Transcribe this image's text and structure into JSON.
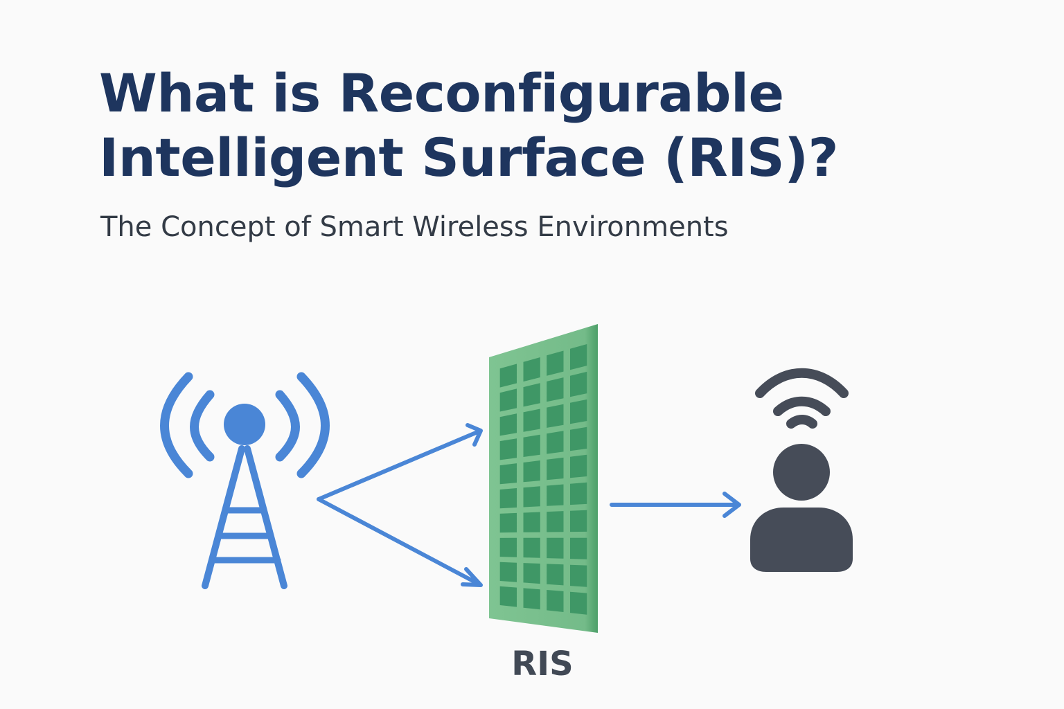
{
  "title": {
    "line1": "What is Reconfigurable",
    "line2": "Intelligent Surface (RIS)?"
  },
  "subtitle": "The Concept of Smart Wireless Environments",
  "diagram": {
    "ris_label": "RIS",
    "nodes": [
      {
        "name": "cell-tower",
        "icon": "cell-tower-icon"
      },
      {
        "name": "ris-panel",
        "icon": "ris-panel-icon"
      },
      {
        "name": "user",
        "icon": "user-wifi-icon"
      }
    ],
    "colors": {
      "signal_blue": "#4a86d6",
      "ris_panel": "#76bd8b",
      "ris_cell": "#3f9766",
      "user_gray": "#464c58",
      "title_navy": "#1e355e"
    }
  }
}
